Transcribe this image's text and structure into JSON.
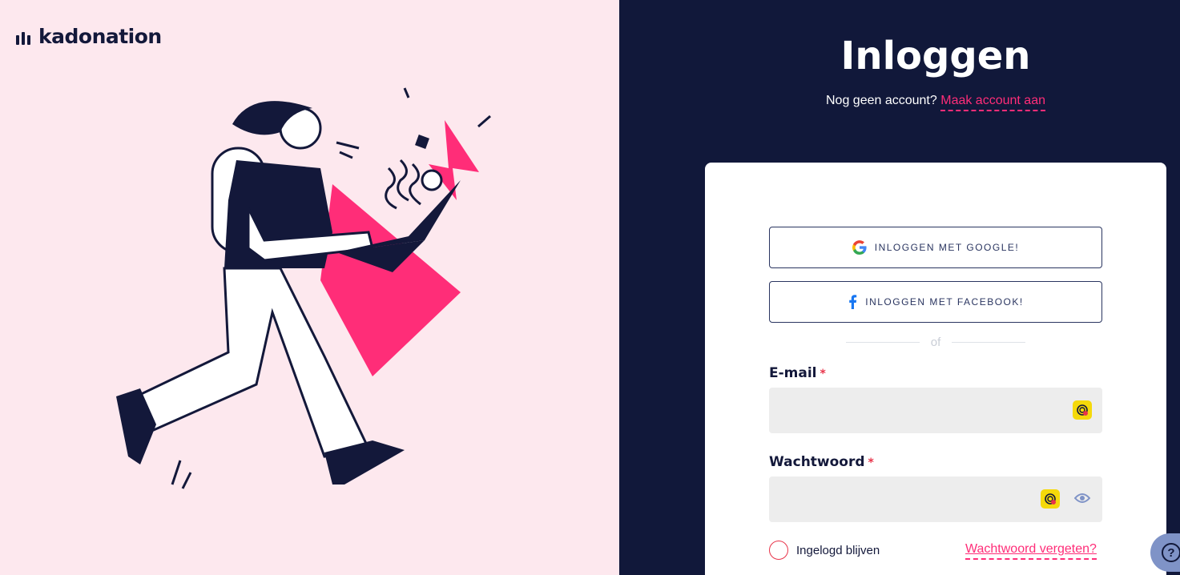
{
  "brand": {
    "name": "kadonation"
  },
  "page": {
    "title": "Inloggen",
    "subtitle_prefix": "Nog geen account?",
    "create_account_link": "Maak account aan"
  },
  "social": {
    "google_label": "INLOGGEN MET GOOGLE!",
    "facebook_label": "INLOGGEN MET FACEBOOK!",
    "divider": "of"
  },
  "form": {
    "email_label": "E-mail",
    "password_label": "Wachtwoord",
    "required_mark": "*",
    "email_value": "",
    "password_value": "",
    "remember_label": "Ingelogd blijven",
    "forgot_link": "Wachtwoord vergeten?"
  },
  "help": {
    "icon": "question-icon"
  },
  "colors": {
    "left_bg": "#fde8ee",
    "right_bg": "#11183a",
    "accent_pink": "#ff2d78",
    "navy": "#13183a"
  }
}
